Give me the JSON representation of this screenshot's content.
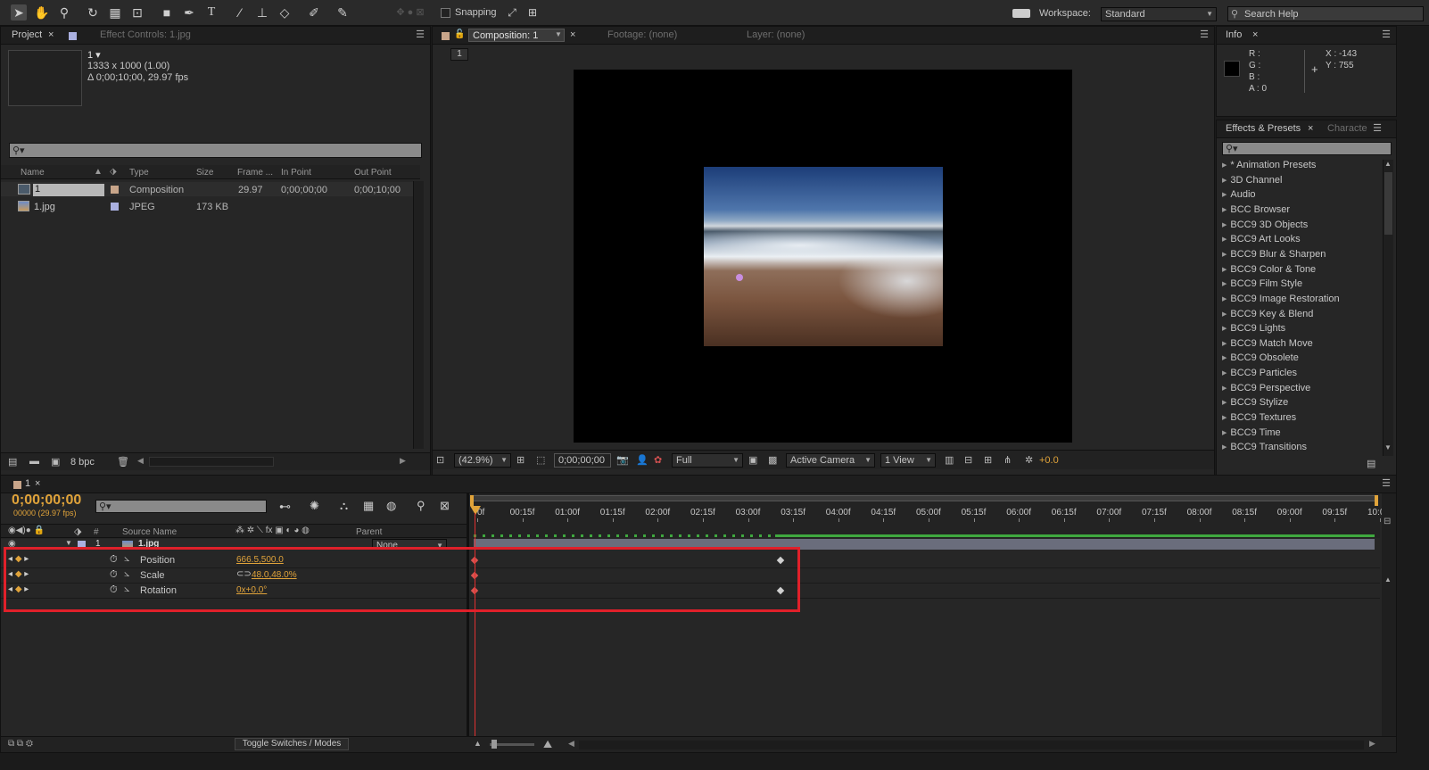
{
  "toolbar": {
    "snapping_label": "Snapping",
    "workspace_label": "Workspace:",
    "workspace_value": "Standard",
    "search_help_placeholder": "Search Help"
  },
  "project": {
    "tab_project": "Project",
    "tab_effect_controls": "Effect Controls: 1.jpg",
    "item_name": "1 ▾",
    "item_dims": "1333 x 1000 (1.00)",
    "item_duration": "Δ 0;00;10;00, 29.97 fps",
    "columns": [
      "Name",
      "Type",
      "Size",
      "Frame ...",
      "In Point",
      "Out Point"
    ],
    "rows": [
      {
        "name": "1",
        "type": "Composition",
        "size": "",
        "frame": "29.97",
        "in": "0;00;00;00",
        "out": "0;00;10;00",
        "icon": "composition-icon"
      },
      {
        "name": "1.jpg",
        "type": "JPEG",
        "size": "173 KB",
        "frame": "",
        "in": "",
        "out": "",
        "icon": "image-file-icon"
      }
    ],
    "bpc": "8 bpc"
  },
  "composition": {
    "tab_composition": "Composition: 1",
    "tab_footage": "Footage: (none)",
    "tab_layer": "Layer: (none)",
    "nav_label": "1",
    "zoom": "(42.9%)",
    "timecode": "0;00;00;00",
    "resolution": "Full",
    "camera": "Active Camera",
    "view": "1 View",
    "exposure": "+0.0"
  },
  "info": {
    "tab": "Info",
    "r": "R :",
    "g": "G :",
    "b": "B :",
    "a": "A : 0",
    "x": "X : -143",
    "y": "Y : 755"
  },
  "effects": {
    "tab": "Effects & Presets",
    "tab2": "Characte",
    "items": [
      "* Animation Presets",
      "3D Channel",
      "Audio",
      "BCC Browser",
      "BCC9 3D Objects",
      "BCC9 Art Looks",
      "BCC9 Blur & Sharpen",
      "BCC9 Color & Tone",
      "BCC9 Film Style",
      "BCC9 Image Restoration",
      "BCC9 Key & Blend",
      "BCC9 Lights",
      "BCC9 Match Move",
      "BCC9 Obsolete",
      "BCC9 Particles",
      "BCC9 Perspective",
      "BCC9 Stylize",
      "BCC9 Textures",
      "BCC9 Time",
      "BCC9 Transitions"
    ]
  },
  "timeline": {
    "tab": "1",
    "timecode": "0;00;00;00",
    "fps": "00000 (29.97 fps)",
    "col_num": "#",
    "col_source": "Source Name",
    "col_parent": "Parent",
    "layer_num": "1",
    "layer_name": "1.jpg",
    "layer_parent": "None",
    "properties": [
      {
        "name": "Position",
        "value": "666.5,500.0"
      },
      {
        "name": "Scale",
        "value": "48.0,48.0%"
      },
      {
        "name": "Rotation",
        "value": "0x+0.0°"
      }
    ],
    "ticks": [
      "0f",
      "00:15f",
      "01:00f",
      "01:15f",
      "02:00f",
      "02:15f",
      "03:00f",
      "03:15f",
      "04:00f",
      "04:15f",
      "05:00f",
      "05:15f",
      "06:00f",
      "06:15f",
      "07:00f",
      "07:15f",
      "08:00f",
      "08:15f",
      "09:00f",
      "09:15f",
      "10:0"
    ],
    "toggle_label": "Toggle Switches / Modes"
  },
  "colors": {
    "accent_orange": "#e0a33a",
    "playhead": "#e03030",
    "highlight_box": "#e0202a",
    "work_area_green": "#3fa83f"
  }
}
